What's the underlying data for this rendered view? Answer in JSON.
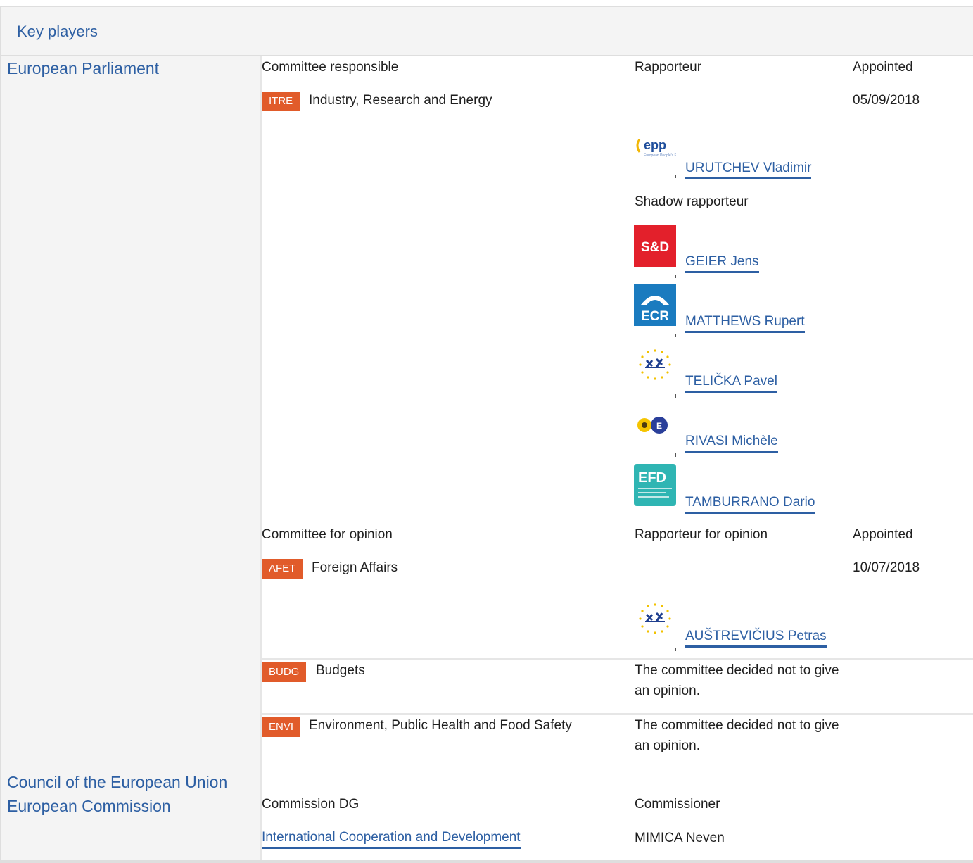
{
  "header": {
    "title": "Key players"
  },
  "institutions": {
    "parliament": "European Parliament",
    "council": "Council of the European Union",
    "commission": "European Commission"
  },
  "responsible": {
    "col_committee": "Committee responsible",
    "col_rapporteur": "Rapporteur",
    "col_appointed": "Appointed",
    "committee_code": "ITRE",
    "committee_name": "Industry, Research and Energy",
    "appointed_date": "05/09/2018",
    "rapporteur": {
      "name": "URUTCHEV Vladimir",
      "group_logo": "epp-logo"
    },
    "shadow_label": "Shadow rapporteur",
    "shadows": [
      {
        "name": "GEIER Jens",
        "group_logo": "sd-logo",
        "logo_text": "S&D"
      },
      {
        "name": "MATTHEWS Rupert",
        "group_logo": "ecr-logo",
        "logo_text": "ECR"
      },
      {
        "name": "TELIČKA Pavel",
        "group_logo": "alde-logo"
      },
      {
        "name": "RIVASI Michèle",
        "group_logo": "greens-efa-logo"
      },
      {
        "name": "TAMBURRANO Dario",
        "group_logo": "efdd-logo",
        "logo_text": "EFD"
      }
    ]
  },
  "opinion": {
    "col_committee": "Committee for opinion",
    "col_rapporteur": "Rapporteur for opinion",
    "col_appointed": "Appointed",
    "committees": [
      {
        "code": "AFET",
        "name": "Foreign Affairs",
        "appointed": "10/07/2018",
        "rapporteur": "AUŠTREVIČIUS Petras",
        "group_logo": "alde-logo"
      },
      {
        "code": "BUDG",
        "name": "Budgets",
        "note": "The committee decided not to give an opinion."
      },
      {
        "code": "ENVI",
        "name": "Environment, Public Health and Food Safety",
        "note": "The committee decided not to give an opinion."
      }
    ]
  },
  "commission": {
    "col_dg": "Commission DG",
    "col_commissioner": "Commissioner",
    "dg": "International Cooperation and Development",
    "commissioner": "MIMICA Neven"
  },
  "colors": {
    "link": "#2d5fa3",
    "badge": "#e15b2a",
    "panel": "#f4f4f4",
    "sd_red": "#e3202b",
    "ecr_blue": "#1a7bbf",
    "efdd_teal": "#2fb5b3"
  }
}
